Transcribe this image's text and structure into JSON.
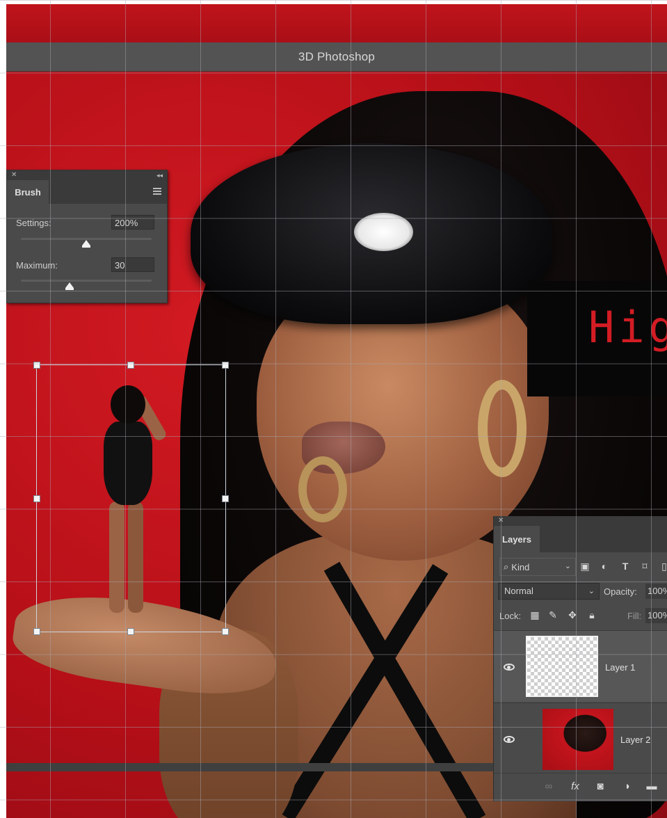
{
  "window": {
    "title": "3D Photoshop"
  },
  "brush_panel": {
    "tab_label": "Brush",
    "settings_label": "Settings:",
    "settings_value": "200%",
    "settings_slider_level": 0.5,
    "maximum_label": "Maximum:",
    "maximum_value": "30",
    "maximum_slider_level": 0.37
  },
  "overlay_text": "Hig",
  "layers_panel": {
    "tab_label": "Layers",
    "kind_label": "Kind",
    "blend_mode": "Normal",
    "opacity_label": "Opacity:",
    "opacity_value": "100%",
    "lock_label": "Lock:",
    "fill_label": "Fill:",
    "fill_value": "100%",
    "layers": [
      {
        "name": "Layer 1",
        "visible": true,
        "selected": true
      },
      {
        "name": "Layer 2",
        "visible": true,
        "selected": false
      }
    ]
  },
  "colors": {
    "canvas_red": "#c0141c",
    "panel_bg": "#4a4a4a",
    "overlay_text": "#d21c24"
  },
  "icons": {
    "filter": [
      "image-filter-icon",
      "adjustment-filter-icon",
      "type-filter-icon",
      "shape-filter-icon",
      "smart-object-filter-icon"
    ],
    "lock": [
      "lock-transparent-icon",
      "lock-paint-icon",
      "lock-position-icon",
      "lock-all-icon"
    ],
    "footer": [
      "link-icon",
      "fx-icon",
      "mask-icon",
      "adjustment-layer-icon",
      "folder-icon"
    ]
  }
}
